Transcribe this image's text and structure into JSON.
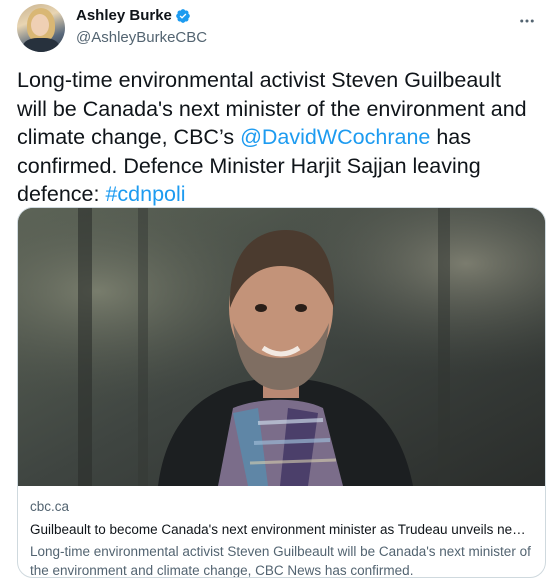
{
  "author": {
    "display_name": "Ashley Burke",
    "handle": "@AshleyBurkeCBC",
    "verified_color": "#1d9bf0",
    "avatar_icon": "profile-photo"
  },
  "tweet": {
    "text_part1": "Long-time environmental activist Steven Guilbeault will be Canada's next minister of the environment and climate change, CBC’s ",
    "mention": "@DavidWCochrane",
    "text_part2": " has confirmed. Defence Minister Harjit Sajjan leaving defence: ",
    "hashtag": "#cdnpoli",
    "link_color": "#1d9bf0"
  },
  "card": {
    "domain": "cbc.ca",
    "title": "Guilbeault to become Canada's next environment minister as Trudeau unveils new cabinet",
    "description": "Long-time environmental activist Steven Guilbeault will be Canada's next minister of the environment and climate change, CBC News has confirmed."
  },
  "icons": {
    "more": "more-horizontal-icon",
    "verified": "verified-badge-icon"
  }
}
